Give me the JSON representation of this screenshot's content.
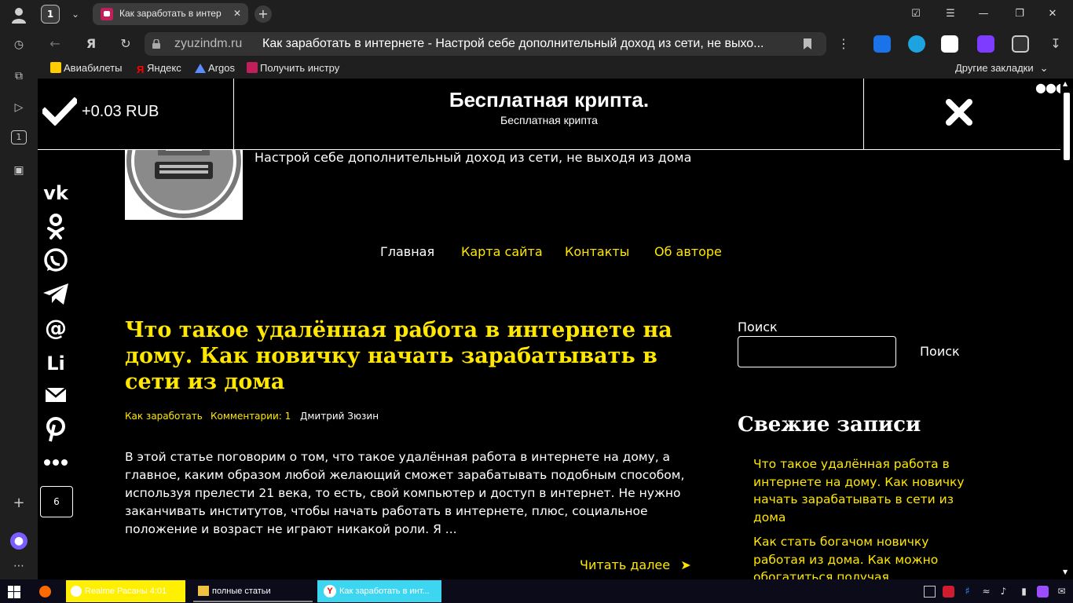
{
  "browser": {
    "tab_count": "1",
    "active_tab_title": "Как заработать в интер",
    "address_domain": "zyuzindm.ru",
    "address_title": "Как заработать в интернете - Настрой себе дополнительный доход из сети, не выхо...",
    "bookmarks": [
      "Авиабилеты",
      "Яндекс",
      "Argos",
      "Получить инстру"
    ],
    "other_bookmarks": "Другие закладки"
  },
  "notice": {
    "reward": "+0.03 RUB",
    "title": "Бесплатная крипта.",
    "subtitle": "Бесплатная крипта"
  },
  "site": {
    "tagline": "Настрой себе дополнительный доход из сети, не выходя из дома",
    "menu": [
      "Главная",
      "Карта сайта",
      "Контакты",
      "Об авторе"
    ]
  },
  "share": {
    "count": "6"
  },
  "post": {
    "title": "Что такое удалённая работа в интернете на дому. Как новичку начать зарабатывать в сети из дома",
    "category": "Как заработать",
    "comments": "Комментарии: 1",
    "author": "Дмитрий Зюзин",
    "excerpt": "В этой статье поговорим о том, что такое удалённая работа в интернете на дому, а главное, каким образом любой желающий сможет зарабатывать подобным способом, используя прелести 21 века, то есть, свой компьютер и доступ в интернет. Не нужно заканчивать институтов, чтобы начать работать в интернете, плюс, социальное положение и возраст не играют никакой роли. Я ...",
    "read_more": "Читать далее"
  },
  "sidebar": {
    "search_label": "Поиск",
    "search_placeholder": "",
    "search_button": "Поиск",
    "recent_title": "Свежие записи",
    "recent_items": [
      "Что такое удалённая работа в интернете на дому. Как новичку начать зарабатывать в сети из дома",
      "Как стать богачом новичку работая из дома. Как можно обогатиться получая дополнительный доход из"
    ]
  },
  "taskbar": {
    "tasks": [
      "Realme Расаны 4:01",
      "полные статьи",
      "Как заработать в инт..."
    ]
  },
  "colors": {
    "accent_yellow": "#ffe700",
    "background": "#000000",
    "chrome": "#1f1f1f"
  }
}
